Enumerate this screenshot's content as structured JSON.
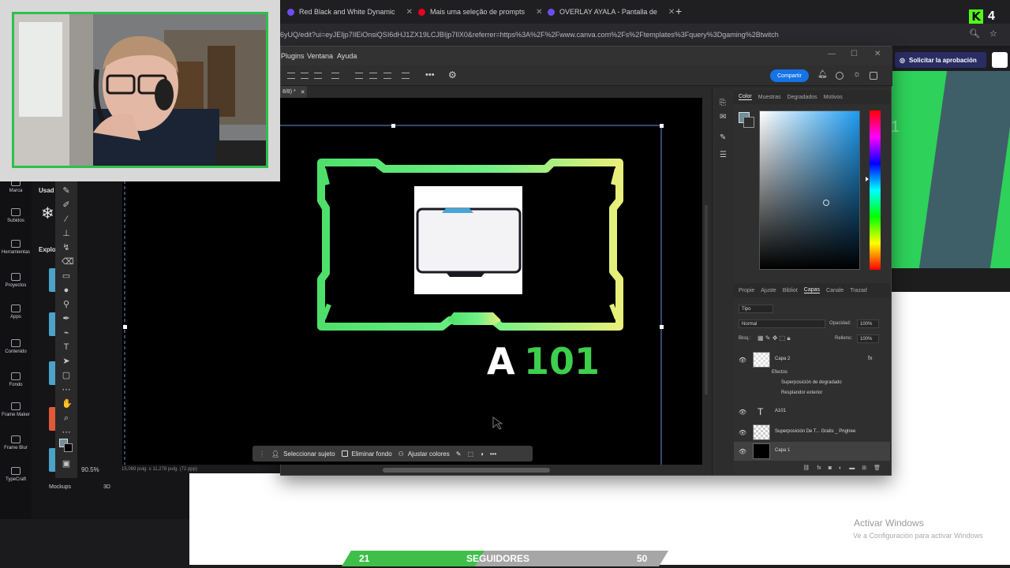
{
  "browser": {
    "tabs": [
      {
        "label": "Red Black and White Dynamic",
        "icon": "canva-icon"
      },
      {
        "label": "Mais uma seleção de prompts",
        "icon": "pinterest-icon"
      },
      {
        "label": "OVERLAY AYALA - Pantalla de",
        "icon": "canva-icon"
      }
    ],
    "url": "6yUQ/edit?ui=eyJEIjp7IlEiOnsiQSI6dHJ1ZX19LCJBIjp7IlX0&referrer=https%3A%2F%2Fwww.canva.com%2Fs%2Ftemplates%3Fquery%3Dgaming%2Btwitch"
  },
  "kick": {
    "viewer_count": "4",
    "logo_letter": "K"
  },
  "canva": {
    "sidebar": [
      "Marca",
      "Subidos",
      "Herramientas",
      "Proyectos",
      "Apps",
      "Contenido",
      "Fondo",
      "Frame Maker",
      "Frame Blur",
      "TypeCraft"
    ],
    "panel_labels": [
      "Usad",
      "Explo"
    ],
    "bottom_labels": [
      "Mockups",
      "3D"
    ],
    "approval_button": "Solicitar la aprobación",
    "preview_text": "1"
  },
  "photoshop": {
    "menu": [
      "Plugins",
      "Ventana",
      "Ayuda"
    ],
    "share_label": "Compartir",
    "doc_tab": "8/8) *",
    "canvas_text_white": "A",
    "canvas_text_green": "101",
    "context_bar": {
      "select_subject": "Seleccionar sujeto",
      "remove_bg": "Eliminar fondo",
      "adjust_colors": "Ajustar colores"
    },
    "zoom": "90.5%",
    "doc_size": "15,069 pulg. x 11,278 pulg. (72 ppp)",
    "color_tabs": [
      "Color",
      "Muestras",
      "Degradados",
      "Motivos"
    ],
    "layer_tabs": [
      "Propie",
      "Ajuste",
      "Bibliot",
      "Capas",
      "Canale",
      "Trazad"
    ],
    "layer_filter": "Tipo",
    "blend_mode": "Normal",
    "opacity_label": "Opacidad:",
    "opacity_value": "100%",
    "lock_label": "Bloq.:",
    "fill_label": "Relleno:",
    "fill_value": "100%",
    "layers": [
      {
        "name": "Capa 2"
      },
      {
        "name": "A101"
      },
      {
        "name": "Superposición De T... Gratis _ Pngtree"
      },
      {
        "name": "Capa 1"
      }
    ],
    "effects_label": "Efectos",
    "effect_1": "Superposición de degradado",
    "effect_2": "Resplandor exterior",
    "colors": {
      "accent": "#1473e6",
      "frame_green": "#4ee06a",
      "frame_yellow": "#e8ef7a",
      "text_green": "#3ecf4d"
    }
  },
  "windows": {
    "activate_title": "Activar Windows",
    "activate_sub": "Ve a Configuración para activar Windows"
  },
  "followers": {
    "current": "21",
    "label": "SEGUIDORES",
    "goal": "50",
    "progress": 0.42
  }
}
